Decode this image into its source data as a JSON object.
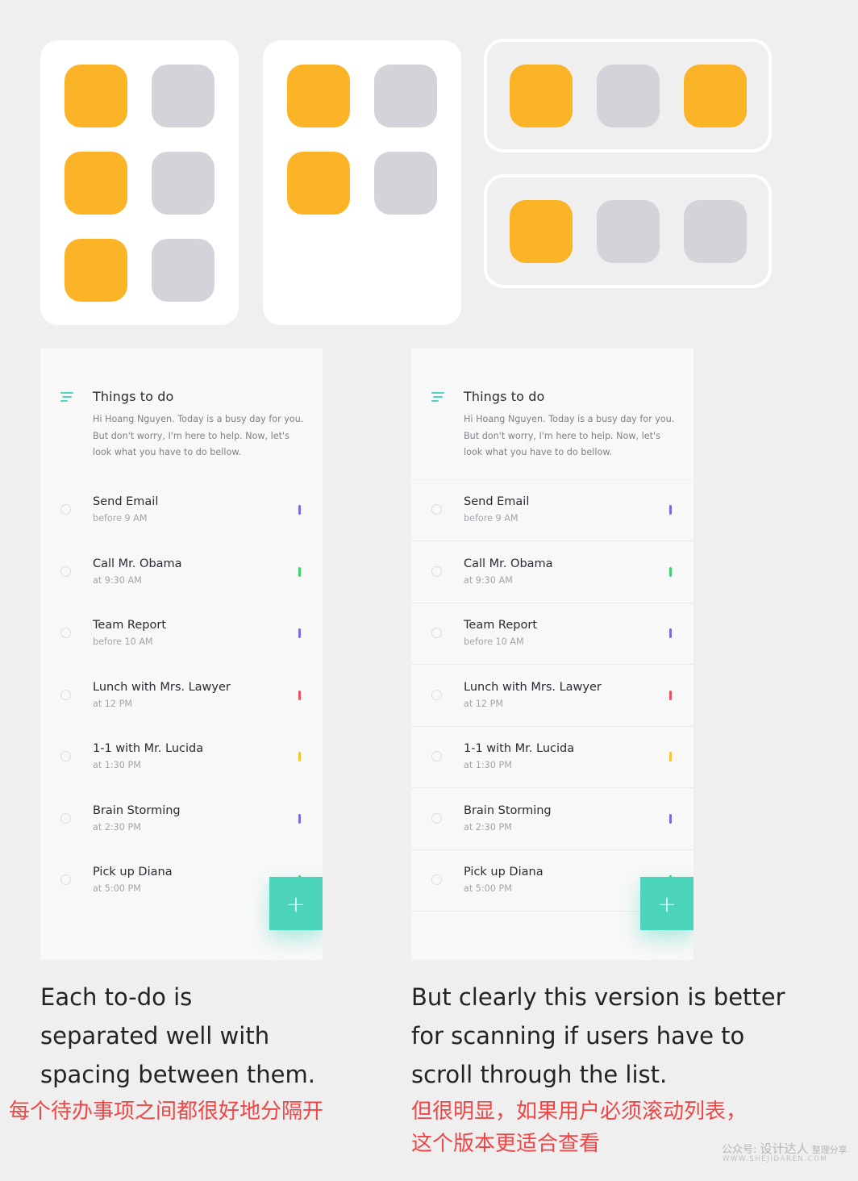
{
  "colors": {
    "background": "#efefef",
    "icon_yellow": "#fbb427",
    "icon_gray": "#d4d3d9",
    "accent_teal": "#4dd4bd",
    "caption_red": "#ef4646",
    "tag_purple": "#7a6ae6",
    "tag_green": "#3dd46b",
    "tag_red": "#ef4f5f",
    "tag_yellow": "#f6c52c"
  },
  "icon_grids": [
    {
      "style": "card",
      "columns": 2,
      "tiles": [
        "yellow",
        "gray",
        "yellow",
        "gray",
        "yellow",
        "gray"
      ]
    },
    {
      "style": "card",
      "columns": 2,
      "tiles": [
        "yellow",
        "gray",
        "yellow",
        "gray"
      ]
    },
    {
      "style": "outlined",
      "columns": 3,
      "tiles": [
        "yellow",
        "gray",
        "yellow"
      ]
    },
    {
      "style": "outlined",
      "columns": 3,
      "tiles": [
        "yellow",
        "gray",
        "gray"
      ]
    }
  ],
  "todo": {
    "title": "Things to do",
    "description": "Hi Hoang Nguyen. Today is a busy day for you. But don't worry, I'm here to help. Now, let's look what you have to do bellow.",
    "menu_icon": "hamburger-menu-icon",
    "items": [
      {
        "title": "Send Email",
        "time": "before 9 AM",
        "tag_color": "#7a6ae6"
      },
      {
        "title": "Call Mr. Obama",
        "time": "at 9:30 AM",
        "tag_color": "#3dd46b"
      },
      {
        "title": "Team Report",
        "time": "before 10 AM",
        "tag_color": "#7a6ae6"
      },
      {
        "title": "Lunch with Mrs. Lawyer",
        "time": "at 12 PM",
        "tag_color": "#ef4f5f"
      },
      {
        "title": "1-1 with Mr. Lucida",
        "time": "at 1:30 PM",
        "tag_color": "#f6c52c"
      },
      {
        "title": "Brain Storming",
        "time": "at 2:30 PM",
        "tag_color": "#7a6ae6"
      },
      {
        "title": "Pick up Diana",
        "time": "at 5:00 PM",
        "tag_color": "#3dd46b"
      }
    ],
    "fab_label": "+"
  },
  "captions": {
    "left_en": [
      "Each to-do is",
      "separated well with",
      "spacing between them."
    ],
    "left_zh": [
      "每个待办事项之间都很好地分隔开"
    ],
    "right_en": [
      "But clearly this version is better",
      "for scanning if users have to",
      "scroll through the list."
    ],
    "right_zh": [
      "但很明显，如果用户必须滚动列表，",
      "这个版本更适合查看"
    ]
  },
  "watermark": {
    "label": "公众号:",
    "brand": "设计达人",
    "suffix": "整理分享",
    "url": "WWW.SHEJIDAREN.COM"
  }
}
